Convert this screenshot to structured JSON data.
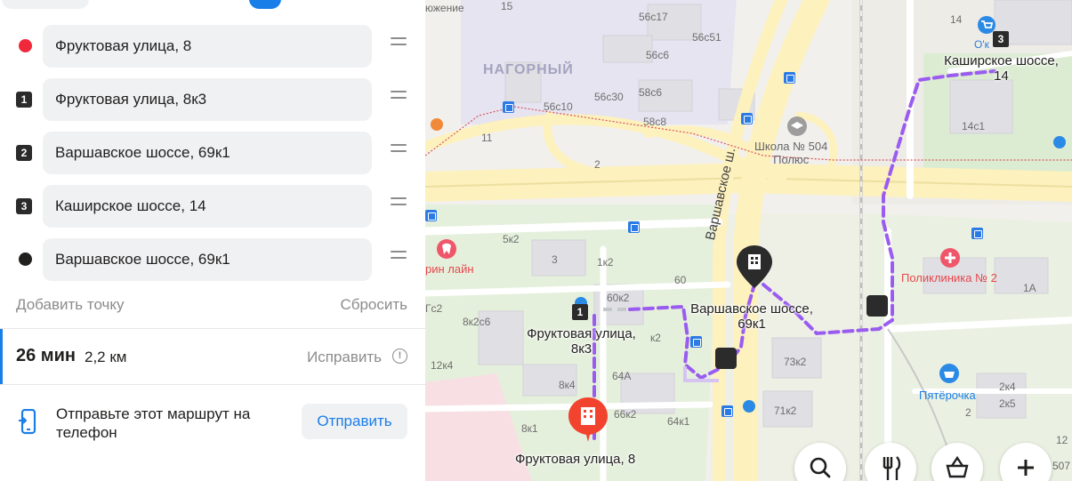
{
  "sidebar": {
    "waypoints": [
      {
        "marker": "start-red-dot",
        "address": "Фруктовая улица, 8"
      },
      {
        "marker": "1",
        "address": "Фруктовая улица, 8к3"
      },
      {
        "marker": "2",
        "address": "Варшавское шоссе, 69к1"
      },
      {
        "marker": "3",
        "address": "Каширское шоссе, 14"
      },
      {
        "marker": "finish-black-dot",
        "address": "Варшавское шоссе, 69к1"
      }
    ],
    "add_point": "Добавить точку",
    "reset": "Сбросить",
    "route": {
      "time": "26 мин",
      "distance": "2,2 км",
      "fix": "Исправить"
    },
    "send": {
      "text": "Отправьте этот маршрут на телефон",
      "button": "Отправить"
    }
  },
  "map": {
    "district": "НАГОРНЫЙ",
    "street_label": "Варшавское ш.",
    "school": {
      "line1": "Школа № 504",
      "line2": "Полюс"
    },
    "clinic": "Поликлиника № 2",
    "shop": "Пятёрочка",
    "dental_partial": "рин лайн",
    "partial_top": "южение",
    "partial_o": "О'к",
    "partial_507": "507",
    "route_labels": {
      "start": "Фруктовая улица, 8",
      "p1": {
        "line1": "Фруктовая улица,",
        "line2": "8к3"
      },
      "p2": {
        "line1": "Варшавское шоссе,",
        "line2": "69к1"
      },
      "p3": {
        "line1": "Каширское шоссе,",
        "line2": "14"
      }
    },
    "markers": {
      "p1": "1",
      "p3": "3"
    },
    "house_numbers": [
      "15",
      "56с17",
      "56с51",
      "56с6",
      "56с30",
      "58с6",
      "56с10",
      "58с8",
      "11",
      "2",
      "5к2",
      "3",
      "1к2",
      "60",
      "60к2",
      "Гс2",
      "8к2с6",
      "к2",
      "12к4",
      "64А",
      "8к4",
      "66к2",
      "64к1",
      "8к1",
      "73к2",
      "71к2",
      "2к4",
      "2к5",
      "14",
      "14с1",
      "1А",
      "2",
      "12"
    ],
    "route_color": "#9a5cf0",
    "tools": [
      "search-icon",
      "food-icon",
      "shop-icon",
      "plus-icon"
    ]
  }
}
